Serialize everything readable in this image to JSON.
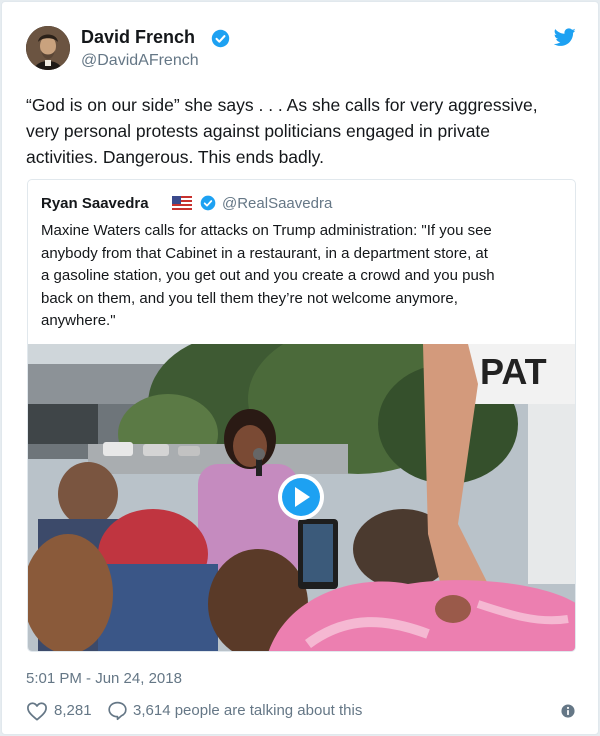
{
  "tweet": {
    "author_name": "David French",
    "author_handle": "@DavidAFrench",
    "text_lines": [
      "“God is on our side” she says . . . As she calls for very aggressive,",
      "very personal protests against politicians  engaged in private",
      "activities. Dangerous. This ends badly."
    ],
    "timestamp": "5:01 PM - Jun 24, 2018",
    "likes": "8,281",
    "talking": "3,614 people are talking about this"
  },
  "quoted": {
    "author_name": "Ryan Saavedra",
    "author_handle": "@RealSaavedra",
    "text_lines": [
      "Maxine Waters calls for attacks on Trump administration: \"If you see",
      "anybody from that Cabinet in a restaurant, in a department store, at",
      "a gasoline station, you get out and you create a crowd and you push",
      "back on them, and you tell them they’re not welcome anymore,",
      "anywhere.\""
    ],
    "media_sign_text": "PAT"
  },
  "icons": {
    "verified": "verified-badge-icon",
    "twitter": "twitter-bird-icon",
    "flag": "us-flag-icon",
    "play": "play-icon",
    "heart": "heart-icon",
    "reply": "speech-bubble-icon",
    "info": "info-icon"
  },
  "colors": {
    "brand": "#1da1f2",
    "text": "#14171a",
    "secondary": "#657786",
    "border": "#e1e8ed"
  }
}
